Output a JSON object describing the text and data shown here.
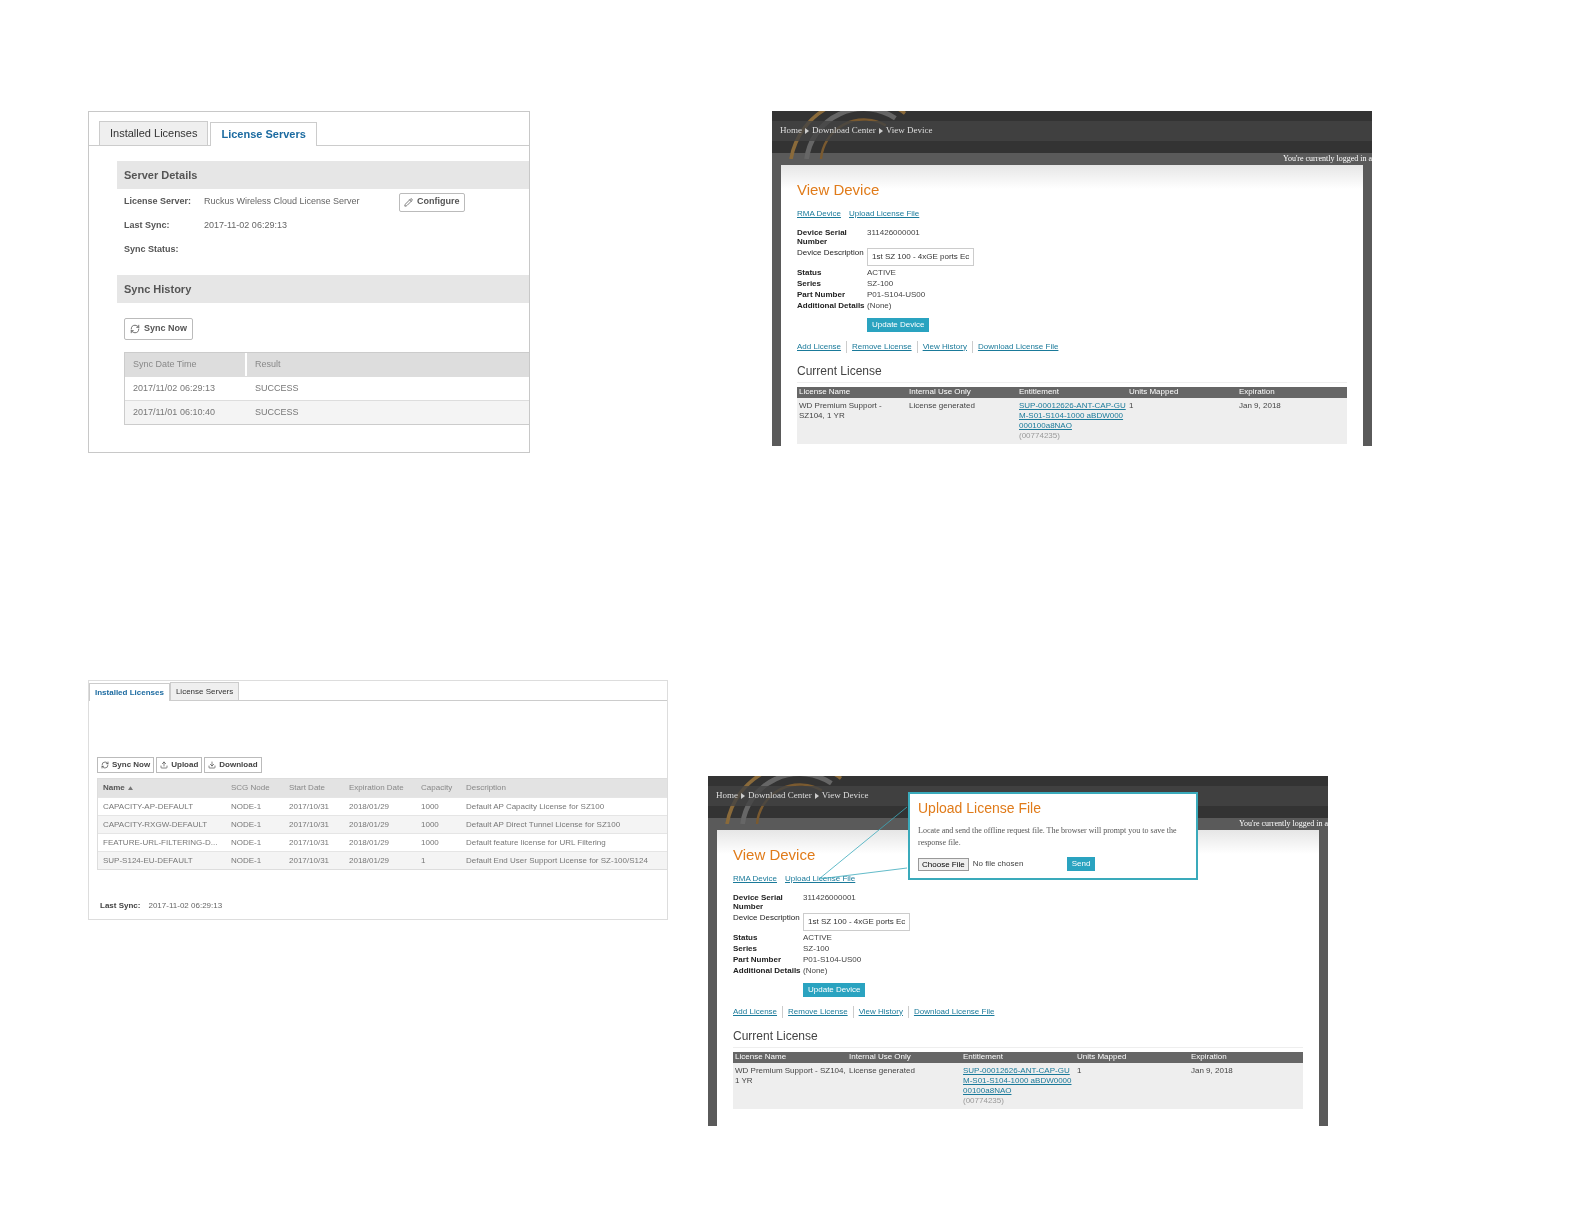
{
  "license_servers_screen": {
    "tabs": [
      {
        "label": "Installed Licenses",
        "selected": false
      },
      {
        "label": "License Servers",
        "selected": true
      }
    ],
    "server_details": {
      "title": "Server Details",
      "fields": [
        {
          "label": "License Server:",
          "value": "Ruckus Wireless Cloud License Server"
        },
        {
          "label": "Last Sync:",
          "value": "2017-11-02 06:29:13"
        },
        {
          "label": "Sync Status:"
        }
      ],
      "configure_button": "Configure"
    },
    "sync_history": {
      "title": "Sync History",
      "sync_button": "Sync Now",
      "columns": [
        "Sync Date Time",
        "Result"
      ],
      "rows": [
        [
          "2017/11/02 06:29:13",
          "SUCCESS"
        ],
        [
          "2017/11/01 06:10:40",
          "SUCCESS"
        ]
      ]
    }
  },
  "view_device_screen": {
    "breadcrumb": [
      "Home",
      "Download Center",
      "View Device"
    ],
    "logged_in": "You're currently logged in a",
    "title": "View Device",
    "links": [
      "RMA Device",
      "Upload License File"
    ],
    "fields": [
      {
        "label": "Device Serial Number",
        "value": "311426000001",
        "kind": "text"
      },
      {
        "label": "Device Description",
        "value": "1st SZ 100 - 4xGE ports Ec",
        "kind": "input"
      },
      {
        "label": "Status",
        "value": "ACTIVE",
        "kind": "text"
      },
      {
        "label": "Series",
        "value": "SZ-100",
        "kind": "text"
      },
      {
        "label": "Part Number",
        "value": "P01-S104-US00",
        "kind": "text"
      },
      {
        "label": "Additional Details",
        "value": "(None)",
        "kind": "text"
      }
    ],
    "update_button": "Update Device",
    "actions": [
      "Add License",
      "Remove License",
      "View History",
      "Download License File"
    ],
    "section_title": "Current License",
    "columns": [
      "License Name",
      "Internal Use Only",
      "Entitlement",
      "Units Mapped",
      "Expiration"
    ],
    "rows": [
      {
        "name": "WD Premium Support - SZ104, 1 YR",
        "internal": "License generated",
        "entitlement": "SUP-00012626-ANT-CAP-GUM-S01-S104-1000 aBDW000000100a8NAO",
        "entitlement_id": "(00774235)",
        "units": "1",
        "expiration": "Jan 9, 2018"
      }
    ]
  },
  "installed_licenses_screen": {
    "tabs": [
      {
        "label": "Installed Licenses",
        "selected": true
      },
      {
        "label": "License Servers",
        "selected": false
      }
    ],
    "buttons": [
      "Sync Now",
      "Upload",
      "Download"
    ],
    "columns": [
      "Name",
      "SCG Node",
      "Start Date",
      "Expiration Date",
      "Capacity",
      "Description"
    ],
    "rows": [
      [
        "CAPACITY-AP-DEFAULT",
        "NODE-1",
        "2017/10/31",
        "2018/01/29",
        "1000",
        "Default AP Capacity License for SZ100"
      ],
      [
        "CAPACITY-RXGW-DEFAULT",
        "NODE-1",
        "2017/10/31",
        "2018/01/29",
        "1000",
        "Default AP Direct Tunnel License for SZ100"
      ],
      [
        "FEATURE-URL-FILTERING-D...",
        "NODE-1",
        "2017/10/31",
        "2018/01/29",
        "1000",
        "Default feature license for URL Filtering"
      ],
      [
        "SUP-S124-EU-DEFAULT",
        "NODE-1",
        "2017/10/31",
        "2018/01/29",
        "1",
        "Default End User Support License for SZ-100/S124"
      ]
    ],
    "last_sync": {
      "label": "Last Sync:",
      "value": "2017-11-02 06:29:13"
    }
  },
  "upload_license_screen": {
    "breadcrumb": [
      "Home",
      "Download Center",
      "View Device"
    ],
    "logged_in": "You're currently logged in a",
    "title": "View Device",
    "links": [
      "RMA Device",
      "Upload License File"
    ],
    "fields": [
      {
        "label": "Device Serial Number",
        "value": "311426000001",
        "kind": "text"
      },
      {
        "label": "Device Description",
        "value": "1st SZ 100 - 4xGE ports Ec",
        "kind": "input"
      },
      {
        "label": "Status",
        "value": "ACTIVE",
        "kind": "text"
      },
      {
        "label": "Series",
        "value": "SZ-100",
        "kind": "text"
      },
      {
        "label": "Part Number",
        "value": "P01-S104-US00",
        "kind": "text"
      },
      {
        "label": "Additional Details",
        "value": "(None)",
        "kind": "text"
      }
    ],
    "update_button": "Update Device",
    "actions": [
      "Add License",
      "Remove License",
      "View History",
      "Download License File"
    ],
    "section_title": "Current License",
    "columns": [
      "License Name",
      "Internal Use Only",
      "Entitlement",
      "Units Mapped",
      "Expiration"
    ],
    "rows": [
      {
        "name": "WD Premium Support - SZ104, 1 YR",
        "internal": "License generated",
        "entitlement": "SUP-00012626-ANT-CAP-GUM-S01-S104-1000 aBDW000000100a8NAO",
        "entitlement_id": "(00774235)",
        "units": "1",
        "expiration": "Jan 9, 2018"
      }
    ],
    "popup": {
      "title": "Upload License File",
      "text": "Locate and send the offline request file. The browser will prompt you to save the response file.",
      "choose_button": "Choose File",
      "file_status": "No file chosen",
      "send_button": "Send"
    }
  }
}
